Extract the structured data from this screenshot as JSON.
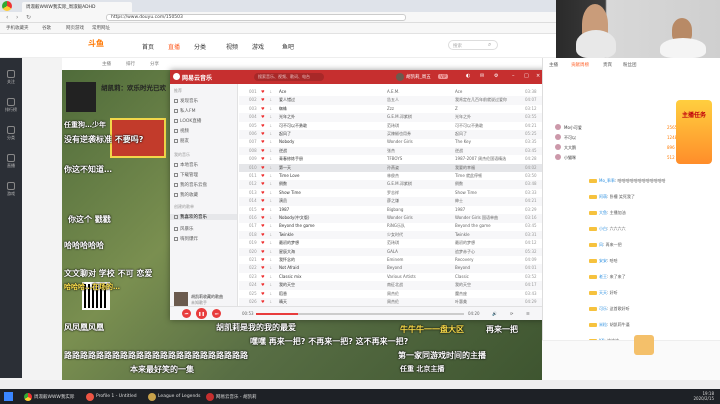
{
  "browser": {
    "tab_title": "周淑毅WWW我实际_周淑毅ADHD",
    "address": "https://www.douyu.com/150503",
    "bookmarks": [
      "手机收藏夹",
      "谷歌",
      "网页游戏",
      "常用网址"
    ]
  },
  "site": {
    "logo": "斗鱼",
    "nav": [
      "首页",
      "直播",
      "分类",
      "视频",
      "游戏",
      "鱼吧"
    ],
    "active_nav": "直播",
    "search_placeholder": "搜索"
  },
  "sidebar": {
    "items": [
      "关注",
      "排行榜",
      "分类",
      "直播",
      "游戏"
    ]
  },
  "stream": {
    "anchor_name": "胡凯莉：欢乐时光已欢",
    "tags": [
      "主播",
      "排行",
      "分享"
    ],
    "danmu": [
      "任重狗…少年",
      "没有逆袭标准 不要吗?",
      "你这不知道…",
      "你这个 戳戳",
      "哈哈哈哈哈",
      "文文聊对 学校 不可 恋爱",
      "哈哈哈…在场的…",
      "风凤凰风凰",
      "胡凯莉是我的我的最爱",
      "牛牛牛一一盘大区",
      "再来一把",
      "嘿嘿 再来一把? 不再来一把? 这不再来一把?",
      "路路路路路路路路路路路路路路路路路路路路路路路",
      "第一家同游戏时间的主播",
      "本来最好笑的一集",
      "任重 北京主播"
    ]
  },
  "player": {
    "title": "网易云音乐",
    "search_placeholder": "搜索音乐、视频、歌词、电台",
    "user": "胡凯莉_周五",
    "vip": "VIP",
    "sidebar_heads": [
      "推荐",
      "我的音乐",
      "创建的歌单"
    ],
    "sidebar_items": [
      "发现音乐",
      "私人FM",
      "LOOK直播",
      "视频",
      "朋友",
      "本地音乐",
      "下载管理",
      "我的音乐云盘",
      "我的收藏",
      "我喜欢的音乐",
      "风暴乐",
      "嗨到爆炸"
    ],
    "now_playing": {
      "title": "胡凯莉收藏的歌曲",
      "artist": "未知歌手"
    },
    "time_current": "00:53",
    "time_total": "04:20",
    "progress": 0.2,
    "songs": [
      {
        "num": "001",
        "title": "Ace",
        "artist": "A.E.M.",
        "album": "Ace",
        "duration": "03:38"
      },
      {
        "num": "002",
        "title": "爱人错过",
        "artist": "告五人",
        "album": "我肯定在几百年前就说过爱你",
        "duration": "04:07"
      },
      {
        "num": "003",
        "title": "蜘蛛",
        "artist": "Zzz",
        "album": "Z",
        "duration": "03:12"
      },
      {
        "num": "004",
        "title": "光年之外",
        "artist": "G.E.M.邓紫棋",
        "album": "光年之外",
        "duration": "03:55"
      },
      {
        "num": "005",
        "title": "可不可以不勇敢",
        "artist": "范玮琪",
        "album": "可不可以不勇敢",
        "duration": "04:21"
      },
      {
        "num": "006",
        "title": "起风了",
        "artist": "买辣椒也用券",
        "album": "起风了",
        "duration": "05:25"
      },
      {
        "num": "007",
        "title": "Nobody",
        "artist": "Wonder Girls",
        "album": "The Key",
        "duration": "03:35"
      },
      {
        "num": "008",
        "title": "逆战",
        "artist": "张杰",
        "album": "逆战",
        "duration": "03:45"
      },
      {
        "num": "009",
        "title": "青春修炼手册",
        "artist": "TFBOYS",
        "album": "1987-2007 周杰伦国语精选",
        "duration": "04:28"
      },
      {
        "num": "010",
        "title": "第一天",
        "artist": "孙燕姿",
        "album": "我要的幸福",
        "duration": "04:02"
      },
      {
        "num": "011",
        "title": "Time Love",
        "artist": "林俊杰",
        "album": "Time 就此停顿",
        "duration": "03:50"
      },
      {
        "num": "012",
        "title": "倒数",
        "artist": "G.E.M.邓紫棋",
        "album": "倒数",
        "duration": "03:48"
      },
      {
        "num": "013",
        "title": "Show Time",
        "artist": "罗志祥",
        "album": "Show Time",
        "duration": "03:33"
      },
      {
        "num": "014",
        "title": "演员",
        "artist": "薛之谦",
        "album": "绅士",
        "duration": "04:21"
      },
      {
        "num": "015",
        "title": "1987",
        "artist": "Bigbang",
        "album": "1987",
        "duration": "03:29"
      },
      {
        "num": "016",
        "title": "Nobody(中文版)",
        "artist": "Wonder Girls",
        "album": "Wonder Girls 国语单曲",
        "duration": "03:16"
      },
      {
        "num": "017",
        "title": "Beyond the game",
        "artist": "RiNG乐队",
        "album": "Beyond the game",
        "duration": "03:45"
      },
      {
        "num": "018",
        "title": "Twinkle",
        "artist": "少女时代",
        "album": "Twinkle",
        "duration": "03:31"
      },
      {
        "num": "019",
        "title": "最初的梦想",
        "artist": "范玮琪",
        "album": "最初的梦想",
        "duration": "04:12"
      },
      {
        "num": "020",
        "title": "星辰大海",
        "artist": "GALA",
        "album": "追梦赤子心",
        "duration": "05:32"
      },
      {
        "num": "021",
        "title": "我怀念的",
        "artist": "Eminem",
        "album": "Recovery",
        "duration": "04:09"
      },
      {
        "num": "022",
        "title": "Not Afraid",
        "artist": "Beyond",
        "album": "Beyond",
        "duration": "04:01"
      },
      {
        "num": "023",
        "title": "Classic mix",
        "artist": "Various Artists",
        "album": "Classic",
        "duration": "03:52"
      },
      {
        "num": "024",
        "title": "我的天空",
        "artist": "南征北战",
        "album": "我的天空",
        "duration": "04:17"
      },
      {
        "num": "025",
        "title": "稻香",
        "artist": "周杰伦",
        "album": "魔杰座",
        "duration": "03:43"
      },
      {
        "num": "026",
        "title": "晴天",
        "artist": "周杰伦",
        "album": "叶惠美",
        "duration": "04:29"
      }
    ]
  },
  "right_panel": {
    "tabs": [
      "主播",
      "贡献周榜",
      "贵宾",
      "粉丝团"
    ],
    "ranks": [
      {
        "name": "Mo小可爱",
        "value": "2565"
      },
      {
        "name": "不可以",
        "value": "1248"
      },
      {
        "name": "大大鹅",
        "value": "896"
      },
      {
        "name": "小猫咪",
        "value": "512"
      }
    ],
    "chat": [
      "哈哈哈哈哈哈哈哈哈哈哈哈",
      "卧槽 笑死我了",
      "主播加油",
      "六六六六",
      "再来一把",
      "哈哈",
      "来了来了",
      "好听",
      "这首歌好听",
      "胡凯莉牛逼",
      "冲冲冲",
      "666"
    ],
    "chat_nicks": [
      "Mo_乖乖",
      "阿萌",
      "大鱼",
      "小白",
      "风",
      "安安",
      "老王",
      "天天",
      "可乐",
      "米粒",
      "KK",
      "泡泡"
    ],
    "promo": "主播任务"
  },
  "taskbar": {
    "items": [
      "周淑毅WWW我实际",
      "Profile 1 - Untitled",
      "League of Legends",
      "网易云音乐 - 胡凯莉"
    ],
    "clock_time": "19:18",
    "clock_date": "2020/2/15"
  },
  "colors": {
    "player_red": "#c62f2f",
    "accent_orange": "#ff5d23"
  }
}
